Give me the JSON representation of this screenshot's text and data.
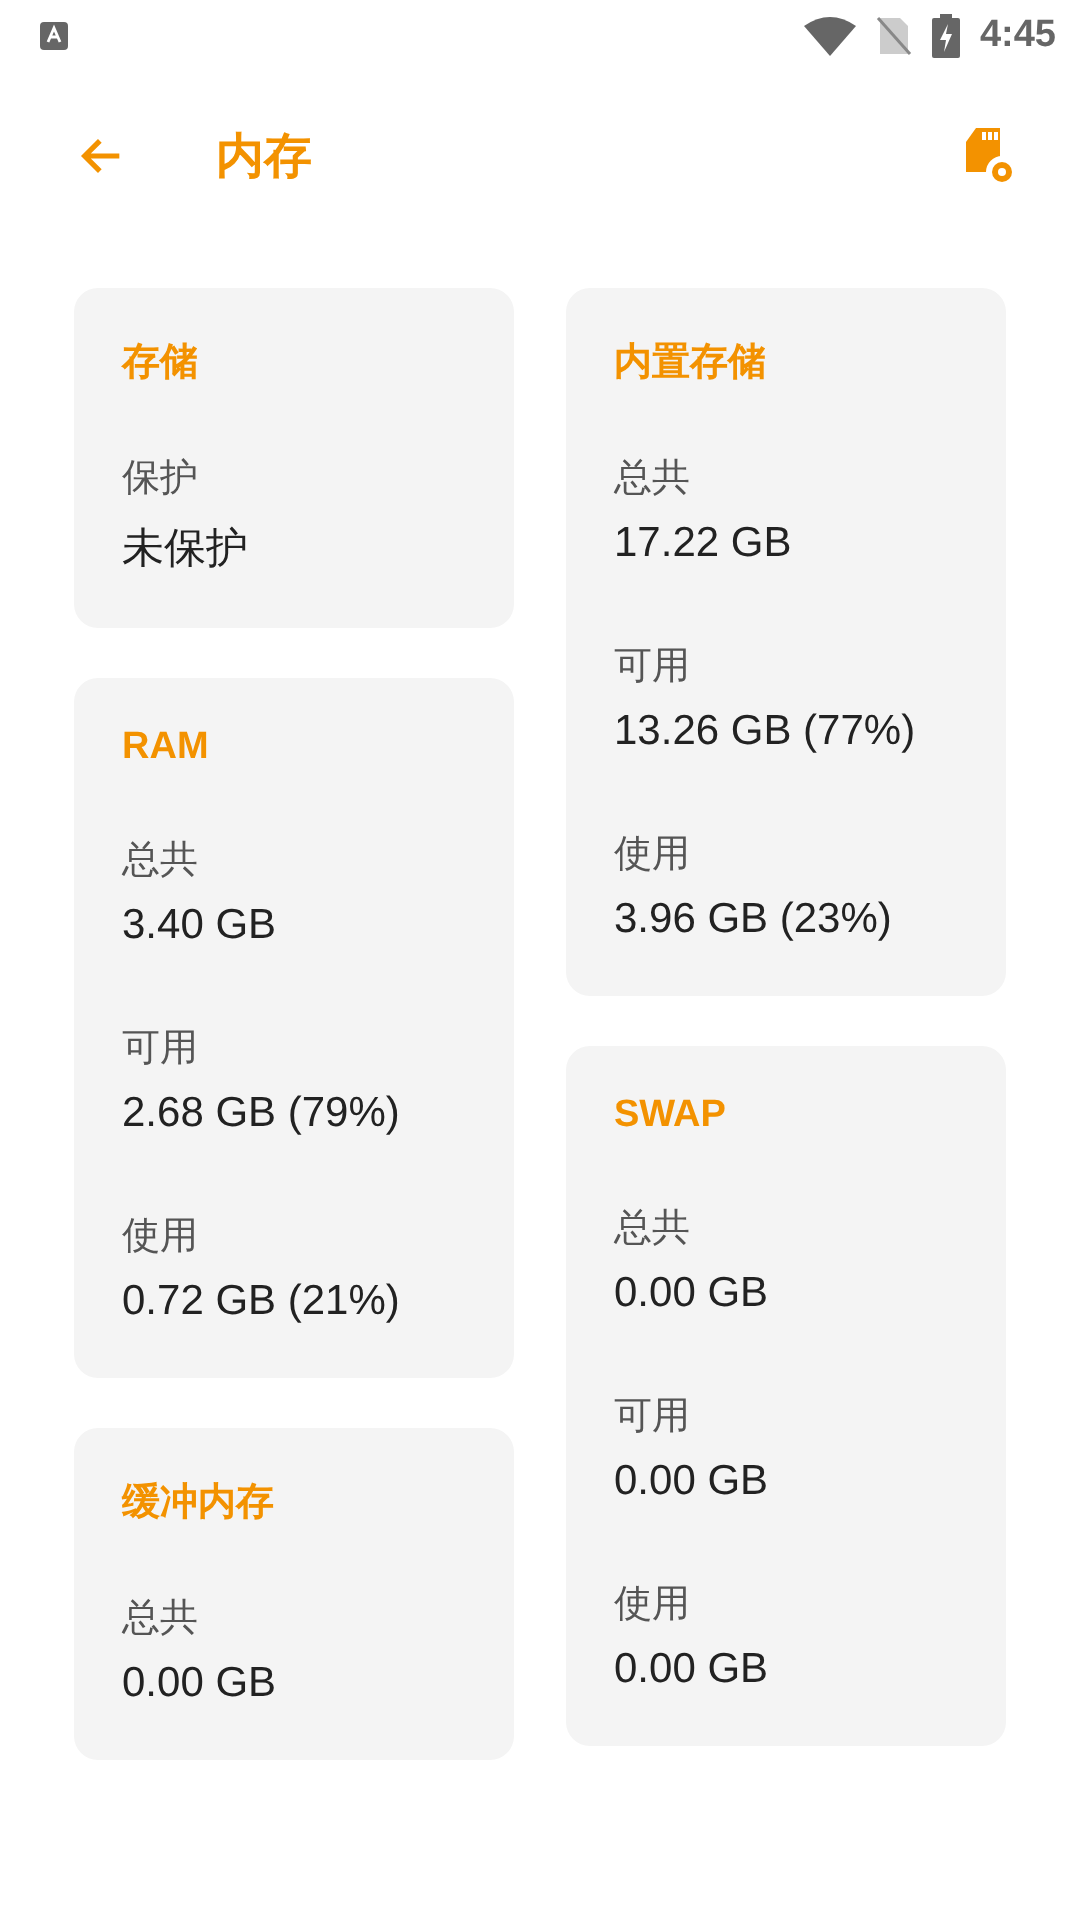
{
  "status_bar": {
    "time": "4:45"
  },
  "app_bar": {
    "title": "内存"
  },
  "columns": [
    {
      "cards": [
        {
          "title": "存储",
          "rows": [
            {
              "label": "保护",
              "value": "未保护"
            }
          ]
        },
        {
          "title": "RAM",
          "rows": [
            {
              "label": "总共",
              "value": "3.40 GB"
            },
            {
              "label": "可用",
              "value": "2.68 GB (79%)"
            },
            {
              "label": "使用",
              "value": "0.72 GB (21%)"
            }
          ]
        },
        {
          "title": "缓冲内存",
          "rows": [
            {
              "label": "总共",
              "value": "0.00 GB"
            }
          ]
        }
      ]
    },
    {
      "cards": [
        {
          "title": "内置存储",
          "rows": [
            {
              "label": "总共",
              "value": "17.22 GB"
            },
            {
              "label": "可用",
              "value": "13.26 GB (77%)"
            },
            {
              "label": "使用",
              "value": "3.96 GB (23%)"
            }
          ]
        },
        {
          "title": "SWAP",
          "rows": [
            {
              "label": "总共",
              "value": "0.00 GB"
            },
            {
              "label": "可用",
              "value": "0.00 GB"
            },
            {
              "label": "使用",
              "value": "0.00 GB"
            }
          ]
        }
      ]
    }
  ]
}
